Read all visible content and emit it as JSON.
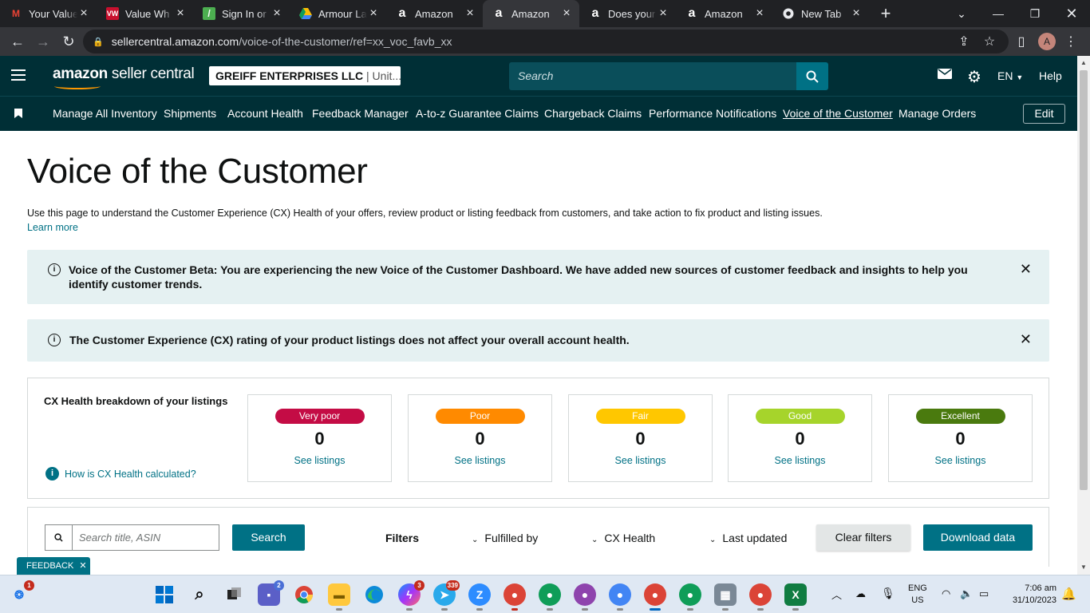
{
  "browser": {
    "tabs": [
      {
        "title": "Your Value",
        "favicon": "gmail-icon",
        "color": "#ea4335"
      },
      {
        "title": "Value Wh",
        "favicon": "vw-icon",
        "color": "#c8102e"
      },
      {
        "title": "Sign In or",
        "favicon": "leaf-icon",
        "color": "#4caf50"
      },
      {
        "title": "Armour La",
        "favicon": "drive-icon",
        "color": "#fbbc04"
      },
      {
        "title": "Amazon",
        "favicon": "amazon-icon",
        "color": "#ffffff"
      },
      {
        "title": "Amazon",
        "favicon": "amazon-icon",
        "color": "#ffffff",
        "active": true
      },
      {
        "title": "Does your",
        "favicon": "amazon-icon",
        "color": "#ffffff"
      },
      {
        "title": "Amazon",
        "favicon": "amazon-icon",
        "color": "#ffffff"
      },
      {
        "title": "New Tab",
        "favicon": "chrome-icon",
        "color": "#ffffff"
      }
    ],
    "url_host": "sellercentral.amazon.com",
    "url_path": "/voice-of-the-customer/ref=xx_voc_favb_xx",
    "profile_initial": "A"
  },
  "header": {
    "logo_bold": "amazon",
    "logo_rest": " seller central",
    "account_name": "GREIFF ENTERPRISES LLC",
    "account_region": " | Unit...",
    "search_placeholder": "Search",
    "language": "EN",
    "help": "Help"
  },
  "nav": {
    "items": [
      "Manage All Inventory",
      "Shipments",
      "Account Health",
      "Feedback Manager",
      "A-to-z Guarantee Claims",
      "Chargeback Claims",
      "Performance Notifications",
      "Voice of the Customer",
      "Manage Orders"
    ],
    "edit": "Edit"
  },
  "page": {
    "title": "Voice of the Customer",
    "intro": "Use this page to understand the Customer Experience (CX) Health of your offers, review product or listing feedback from customers, and take action to fix product and listing issues.",
    "learn_more": "Learn more",
    "alert1": "Voice of the Customer Beta: You are experiencing the new Voice of the Customer Dashboard. We have added new sources of customer feedback and insights to help you identify customer trends.",
    "alert2": "The Customer Experience (CX) rating of your product listings does not affect your overall account health."
  },
  "cx": {
    "title": "CX Health breakdown of your listings",
    "help_link": "How is CX Health calculated?",
    "see_label": "See listings",
    "cards": [
      {
        "label": "Very poor",
        "count": "0",
        "color": "#c40c45",
        "text_color": "#ffffff"
      },
      {
        "label": "Poor",
        "count": "0",
        "color": "#ff8a00",
        "text_color": "#ffffff"
      },
      {
        "label": "Fair",
        "count": "0",
        "color": "#ffc700",
        "text_color": "#ffffff"
      },
      {
        "label": "Good",
        "count": "0",
        "color": "#a6d42b",
        "text_color": "#ffffff"
      },
      {
        "label": "Excellent",
        "count": "0",
        "color": "#4a7a0e",
        "text_color": "#ffffff"
      }
    ]
  },
  "listing_search": {
    "placeholder": "Search title, ASIN",
    "search_button": "Search",
    "filters_label": "Filters",
    "filter_fulfilled": "Fulfilled by",
    "filter_cx": "CX Health",
    "filter_updated": "Last updated",
    "clear_filters": "Clear filters",
    "download": "Download data"
  },
  "feedback_tab": "FEEDBACK",
  "taskbar": {
    "lang_top": "ENG",
    "lang_bottom": "US",
    "time": "7:06 am",
    "date": "31/10/2023",
    "badges": {
      "weather": "1",
      "teams": "2",
      "messenger": "3",
      "telegram": "339"
    }
  }
}
